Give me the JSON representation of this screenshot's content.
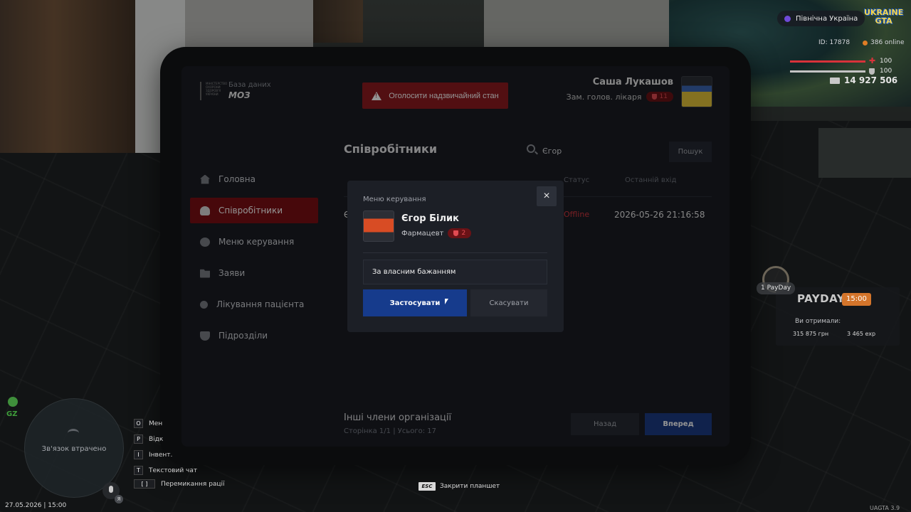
{
  "hud": {
    "server": "Північна Україна",
    "brand_line1": "UKRAINE",
    "brand_line2": "GTA",
    "player_id": "ID: 17878",
    "online": "386 online",
    "health": "100",
    "armor": "100",
    "money": "14 927 506",
    "payday_chip": "1 PayDay",
    "payday_title": "PAYDAY",
    "payday_time": "15:00",
    "payday_received_label": "Ви отримали:",
    "payday_money": "315 875 грн",
    "payday_exp": "3 465 exp",
    "gz": "GZ",
    "minimap_status": "Зв'язок втрачено",
    "lang": "Я",
    "datetime": "27.05.2026 | 15:00",
    "version": "UAGTA 3.9",
    "esc_key": "ESC",
    "esc_label": "Закрити планшет",
    "keys": [
      {
        "key": "O",
        "label": "Мен"
      },
      {
        "key": "P",
        "label": "Відк"
      },
      {
        "key": "I",
        "label": "Інвент."
      },
      {
        "key": "T",
        "label": "Текстовий чат"
      },
      {
        "key": "[ ]",
        "label": "Перемикання рації"
      }
    ]
  },
  "tablet": {
    "org_subtitle": "База даних",
    "org_name": "МОЗ",
    "org_logo_text": "МІНІСТЕРСТВО ОХОРОНИ ЗДОРОВ'Я УКРАЇНИ",
    "emergency_label": "Оголосити надзвичайний стан",
    "user_name": "Саша Лукашов",
    "user_role": "Зам. голов. лікаря",
    "user_rank": "11",
    "nav": [
      {
        "label": "Головна",
        "icon": "home-icon"
      },
      {
        "label": "Співробітники",
        "icon": "users-icon",
        "active": true
      },
      {
        "label": "Меню керування",
        "icon": "gear-icon"
      },
      {
        "label": "Заяви",
        "icon": "folder-icon"
      },
      {
        "label": "Лікування пацієнта",
        "icon": "sun-icon"
      },
      {
        "label": "Підрозділи",
        "icon": "shield-icon"
      }
    ],
    "main_title": "Співробітники",
    "search_value": "Єгор",
    "search_button": "Пошук",
    "columns": {
      "status": "Статус",
      "last_login": "Останній вхід"
    },
    "row": {
      "name": "Є",
      "status": "Offline",
      "last_login": "2026-05-26 21:16:58"
    },
    "others_title": "Інші члени організації",
    "others_sub": "Сторінка 1/1 | Усього: 17",
    "back_label": "Назад",
    "next_label": "Вперед"
  },
  "modal": {
    "title": "Меню керування",
    "close": "×",
    "employee_name": "Єгор Білик",
    "employee_role": "Фармацевт",
    "employee_rank": "2",
    "reason_value": "За власним бажанням",
    "apply_label": "Застосувати",
    "cancel_label": "Скасувати"
  },
  "colors": {
    "accent_red": "#7a0e13",
    "primary_blue": "#163b8c",
    "status_offline": "#d1363f"
  }
}
